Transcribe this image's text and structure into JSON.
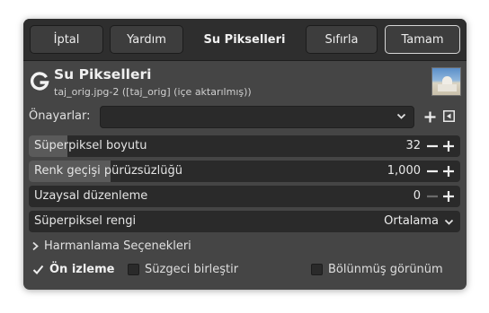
{
  "header": {
    "cancel_label": "İptal",
    "help_label": "Yardım",
    "title": "Su Pikselleri",
    "reset_label": "Sıfırla",
    "ok_label": "Tamam"
  },
  "plugin": {
    "title": "Su Pikselleri",
    "subtitle": "taj_orig.jpg-2 ([taj_orig] (içe aktarılmış))"
  },
  "presets": {
    "label": "Önayarlar:",
    "value": ""
  },
  "params": [
    {
      "label": "Süperpiksel boyutu",
      "value": "32",
      "fill_fraction": 0.09
    },
    {
      "label": "Renk geçişi pürüzsüzlüğü",
      "value": "1,000",
      "fill_fraction": 0.19
    },
    {
      "label": "Uzaysal düzenleme",
      "value": "0",
      "fill_fraction": 0
    }
  ],
  "color_option": {
    "label": "Süperpiksel rengi",
    "value": "Ortalama"
  },
  "blending": {
    "label": "Harmanlama Seçenekleri"
  },
  "checks": {
    "preview": {
      "label": "Ön izleme",
      "checked": true
    },
    "merge": {
      "label": "Süzgeci birleştir",
      "checked": false
    },
    "split": {
      "label": "Bölünmüş görünüm",
      "checked": false
    }
  },
  "colors": {
    "dialog_bg": "#454545",
    "header_bg": "#2e2e2e",
    "field_bg": "#2a2a2a",
    "fill": "#5a5a5a"
  }
}
